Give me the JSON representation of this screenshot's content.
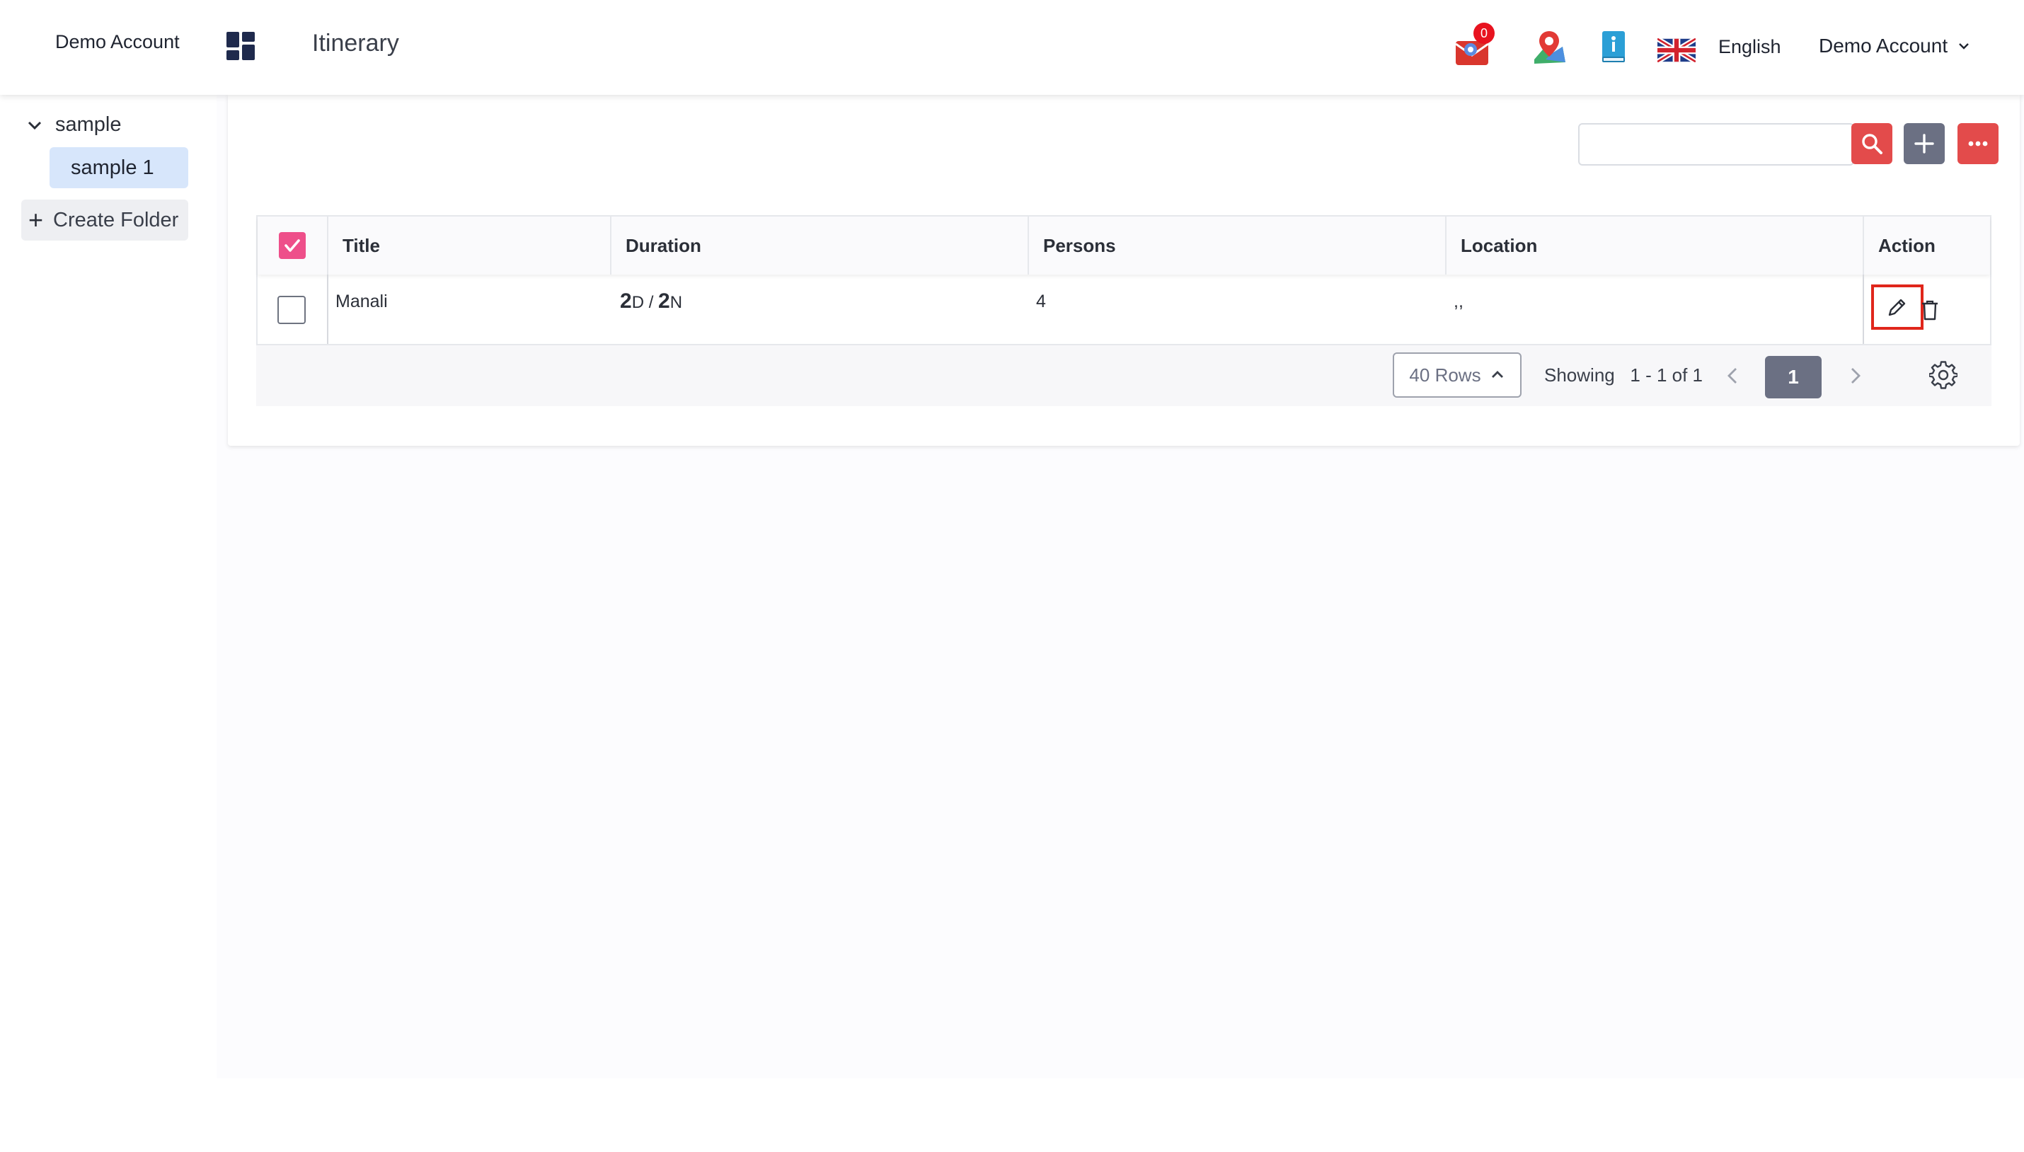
{
  "header": {
    "brand": "Demo Account",
    "page_title": "Itinerary",
    "mail_badge": "0",
    "language": "English",
    "account": "Demo Account"
  },
  "sidebar": {
    "folder": "sample",
    "items": [
      {
        "label": "sample 1",
        "selected": true
      }
    ],
    "create_folder": "Create Folder"
  },
  "toolbar": {
    "search_placeholder": ""
  },
  "table": {
    "columns": [
      "Title",
      "Duration",
      "Persons",
      "Location",
      "Action"
    ],
    "header_checked": true,
    "rows": [
      {
        "checked": false,
        "title": "Manali",
        "duration": {
          "days": "2",
          "days_unit": "D",
          "sep": " / ",
          "nights": "2",
          "nights_unit": "N"
        },
        "persons": "4",
        "location": ",,"
      }
    ]
  },
  "pagination": {
    "rows_label": "40 Rows",
    "showing": "Showing   1 - 1 of 1",
    "current_page": "1"
  },
  "colors": {
    "accent_red": "#e34b4b",
    "slate": "#6b7083",
    "checkbox_pink": "#ee4f8a",
    "highlight_border": "#e0261b"
  }
}
